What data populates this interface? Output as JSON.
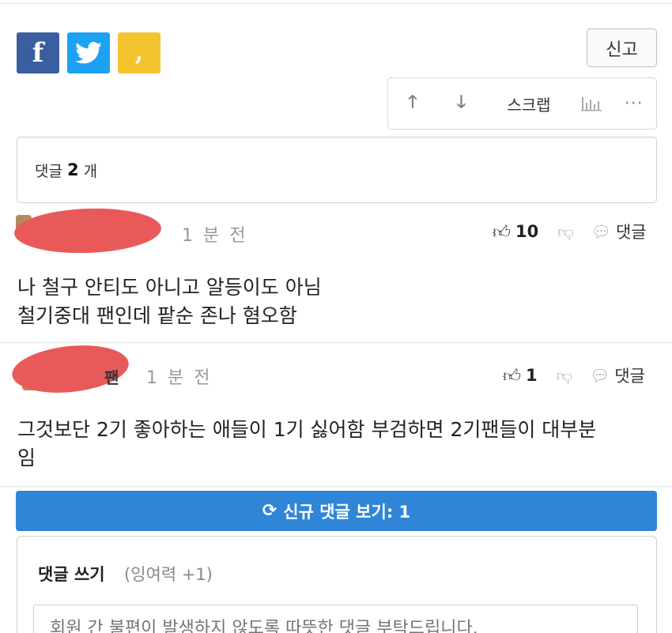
{
  "share": {
    "facebook_glyph": "f",
    "twitter_glyph": "t",
    "kakao_glyph": ","
  },
  "report_label": "신고",
  "actions": {
    "scrap_label": "스크랩",
    "more_label": "···"
  },
  "comment_count": {
    "prefix": "댓글",
    "count": "2",
    "suffix": "개"
  },
  "comments": [
    {
      "time": "1 분 전",
      "likes": "10",
      "reply_label": "댓글",
      "body_line1": "나 철구 안티도 아니고 알등이도 아님",
      "body_line2": "철기중대 팬인데 팥순 존나 혐오함"
    },
    {
      "name_tail": "팬",
      "time": "1 분 전",
      "likes": "1",
      "reply_label": "댓글",
      "body_line1": "그것보단 2기 좋아하는 애들이 1기 싫어함 부검하면 2기팬들이 대부분",
      "body_line2": "임"
    }
  ],
  "new_comments_label": "신규 댓글 보기: 1",
  "write": {
    "title": "댓글 쓰기",
    "sub": "(잉여력 +1)",
    "placeholder": "회원 간 불편이 발생하지 않도록 따뜻한 댓글 부탁드립니다."
  },
  "colors": {
    "facebook": "#3b5ea0",
    "twitter": "#1da1f2",
    "kakao": "#f4c430",
    "primary_button": "#2f86d6",
    "redaction": "#e85a5a"
  }
}
